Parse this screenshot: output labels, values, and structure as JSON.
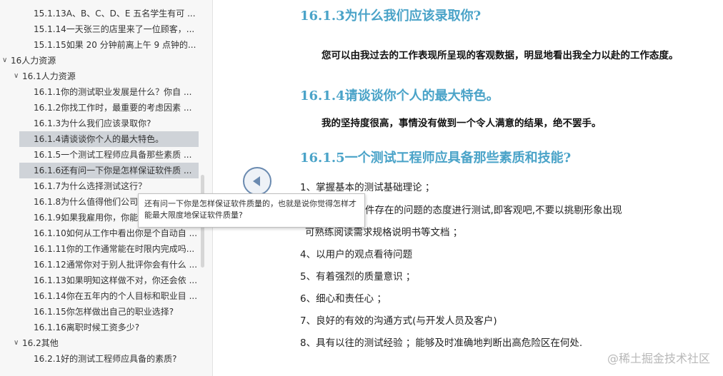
{
  "toc": [
    {
      "level": 3,
      "label": "15.1.13A、B、C、D、E 五名学生有可 ..."
    },
    {
      "level": 3,
      "label": "15.1.14一天张三的店里来了一位顾客，..."
    },
    {
      "level": 3,
      "label": "15.1.15如果 20 分钟前离上午 9 点钟的..."
    },
    {
      "level": 1,
      "label": "16人力资源",
      "expanded": true
    },
    {
      "level": 2,
      "label": "16.1人力资源",
      "expanded": true
    },
    {
      "level": 3,
      "label": "16.1.1你的测试职业发展是什么？你自 ..."
    },
    {
      "level": 3,
      "label": "16.1.2你找工作时，最重要的考虑因素 ..."
    },
    {
      "level": 3,
      "label": "16.1.3为什么我们应该录取你?"
    },
    {
      "level": 3,
      "label": "16.1.4请谈谈你个人的最大特色。",
      "highlight": true
    },
    {
      "level": 3,
      "label": "16.1.5一个测试工程师应具备那些素质 ..."
    },
    {
      "level": 3,
      "label": "16.1.6还有问一下你是怎样保证软件质 ...",
      "highlight": true
    },
    {
      "level": 3,
      "label": "16.1.7为什么选择测试这行？"
    },
    {
      "level": 3,
      "label": "16.1.8为什么值得他们公司雇用呢？"
    },
    {
      "level": 3,
      "label": "16.1.9如果我雇用你，你能为部门带..."
    },
    {
      "level": 3,
      "label": "16.1.10如何从工作中看出你是个自动自 ..."
    },
    {
      "level": 3,
      "label": "16.1.11你的工作通常能在时限内完成吗..."
    },
    {
      "level": 3,
      "label": "16.1.12通常你对于别人批评你会有什么 ..."
    },
    {
      "level": 3,
      "label": "16.1.13如果明知这样做不对，你还会依 ..."
    },
    {
      "level": 3,
      "label": "16.1.14你在五年内的个人目标和职业目 ..."
    },
    {
      "level": 3,
      "label": "16.1.15你怎样做出自己的职业选择?"
    },
    {
      "level": 3,
      "label": "16.1.16离职时候工资多少?"
    },
    {
      "level": 2,
      "label": "16.2其他",
      "expanded": true
    },
    {
      "level": 3,
      "label": "16.2.1好的测试工程师应具备的素质?"
    }
  ],
  "tooltip": {
    "text": "还有问一下你是怎样保证软件质量的，也就是说你觉得怎样才能最大限度地保证软件质量?"
  },
  "collapse_button": {
    "icon": "triangle-left-icon"
  },
  "content": {
    "h_1613": "16.1.3为什么我们应该录取你?",
    "p_1613": "您可以由我过去的工作表现所呈现的客观数据，明显地看出我全力以赴的工作态度。",
    "h_1614": "16.1.4请谈谈你个人的最大特色。",
    "p_1614": "我的坚持度很高，事情没有做到一个令人满意的结果，绝不罢手。",
    "h_1615": "16.1.5一个测试工程师应具备那些素质和技能?",
    "list": [
      "1、掌握基本的测试基础理论 ；",
      "件存在的问题的态度进行测试,即客观吧,不要以挑剔形象出现",
      "可熟练阅读需求规格说明书等文档 ；",
      "4、以用户的观点看待问题",
      "5、有着强烈的质量意识 ；",
      "6、细心和责任心 ；",
      "7、良好的有效的沟通方式(与开发人员及客户)",
      "8、具有以往的测试经验 ；能够及时准确地判断出高危险区在何处."
    ]
  },
  "watermark": {
    "text": "@稀土掘金技术社区"
  },
  "colors": {
    "heading": "#4aa3c8",
    "highlight": "#cfd3d8",
    "button_accent": "#6a8ab0"
  }
}
